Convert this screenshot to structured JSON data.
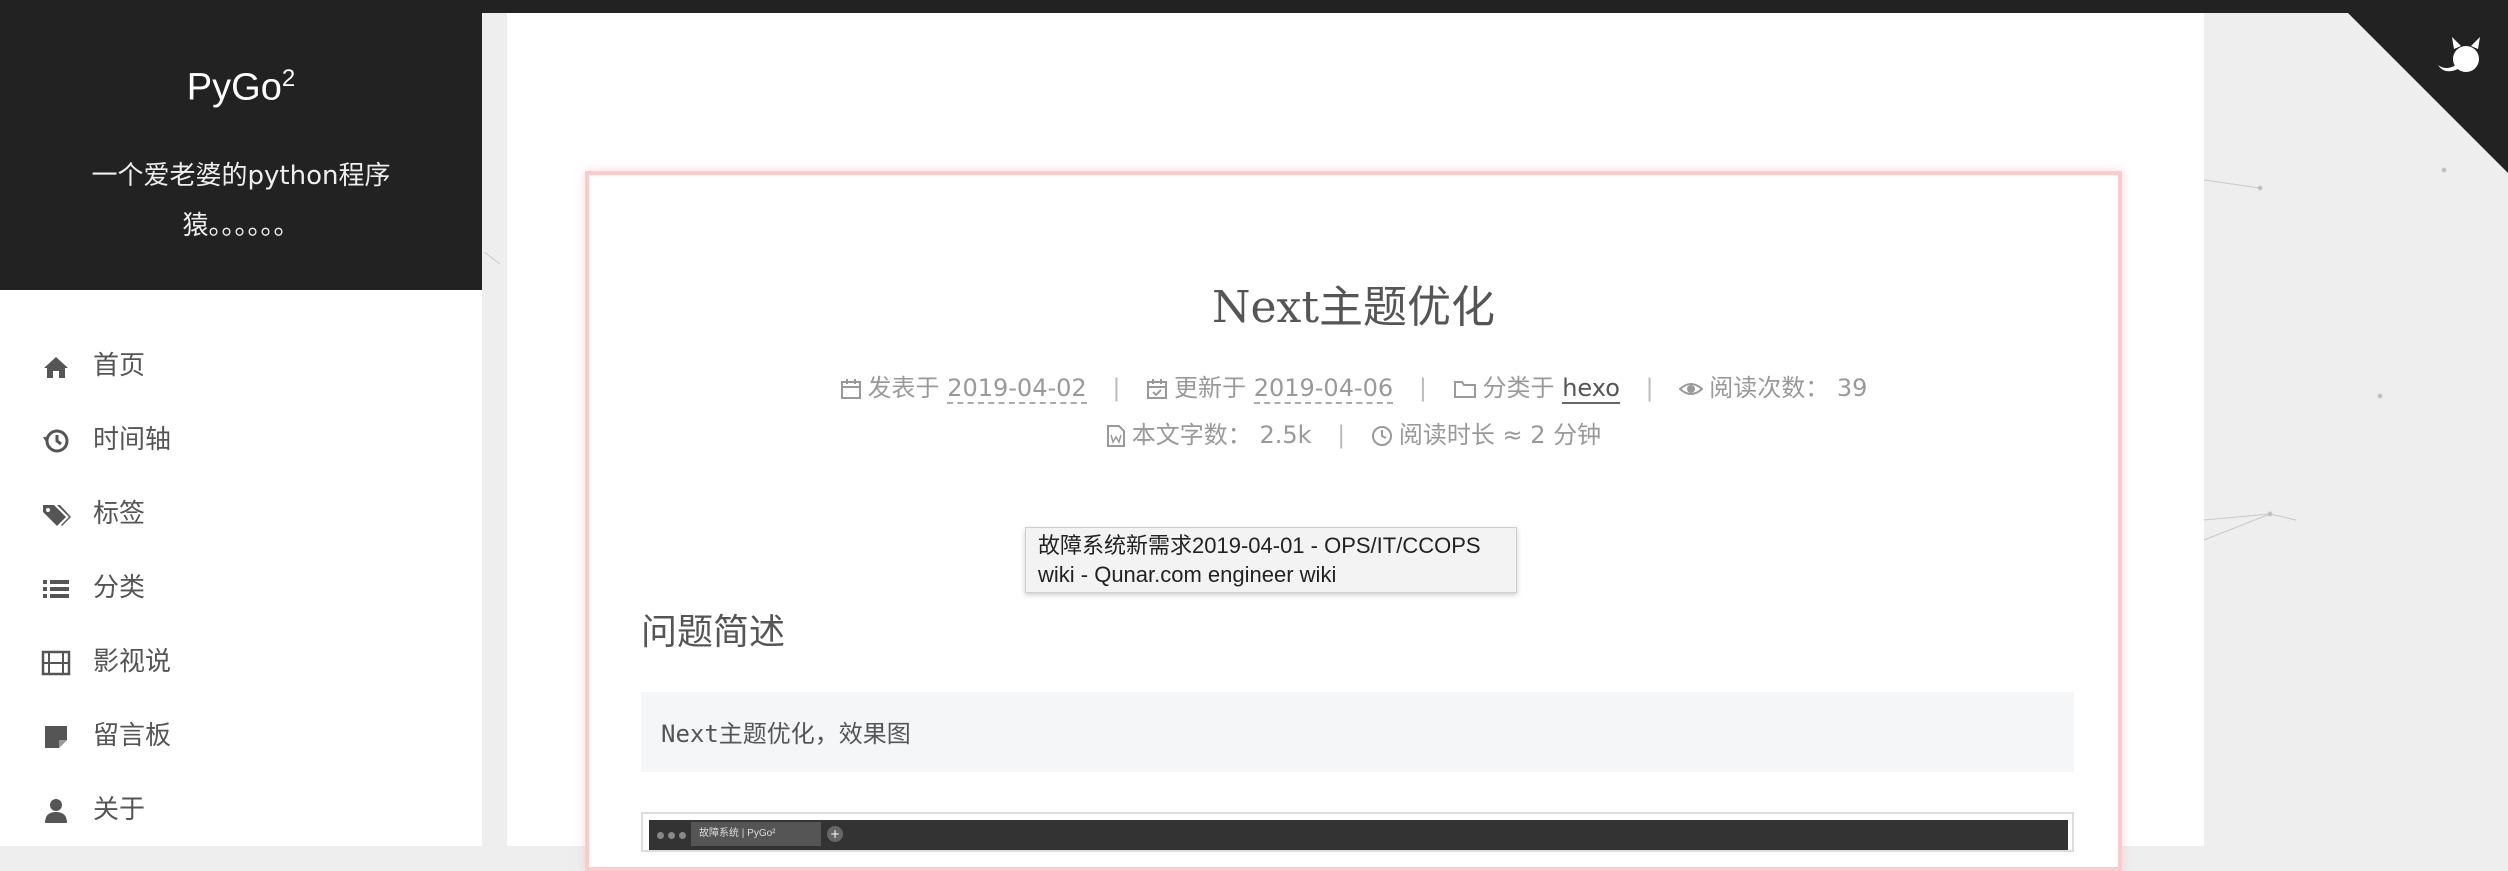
{
  "brand": {
    "title": "PyGo",
    "title_sup": "2",
    "subtitle": "一个爱老婆的python程序猿。。。。。。"
  },
  "menu": [
    {
      "label": "首页",
      "icon": "home-icon"
    },
    {
      "label": "时间轴",
      "icon": "history-icon"
    },
    {
      "label": "标签",
      "icon": "tags-icon"
    },
    {
      "label": "分类",
      "icon": "list-icon"
    },
    {
      "label": "影视说",
      "icon": "film-icon"
    },
    {
      "label": "留言板",
      "icon": "sticky-note-icon"
    },
    {
      "label": "关于",
      "icon": "user-icon"
    }
  ],
  "post": {
    "title": "Next主题优化",
    "meta": {
      "posted_label": "发表于",
      "posted_date": "2019-04-02",
      "updated_label": "更新于",
      "updated_date": "2019-04-06",
      "category_label": "分类于",
      "category": "hexo",
      "views_label": "阅读次数：",
      "views": "39",
      "wordcount_label": "本文字数：",
      "wordcount": "2.5k",
      "readtime_label": "阅读时长 ≈",
      "readtime": "2 分钟",
      "separator": "|"
    },
    "section_heading": "问题简述",
    "code_text": "Next主题优化，效果图",
    "screenshot_tab": "故障系统 | PyGo²",
    "screenshot_plus": "+"
  },
  "tooltip": {
    "line1": "故障系统新需求2019-04-01 - OPS/IT/CCOPS",
    "line2": "wiki - Qunar.com engineer wiki"
  },
  "colors": {
    "sidebar_header": "#222222",
    "post_border": "#ffcaca",
    "page_bg": "#eeeeee"
  }
}
